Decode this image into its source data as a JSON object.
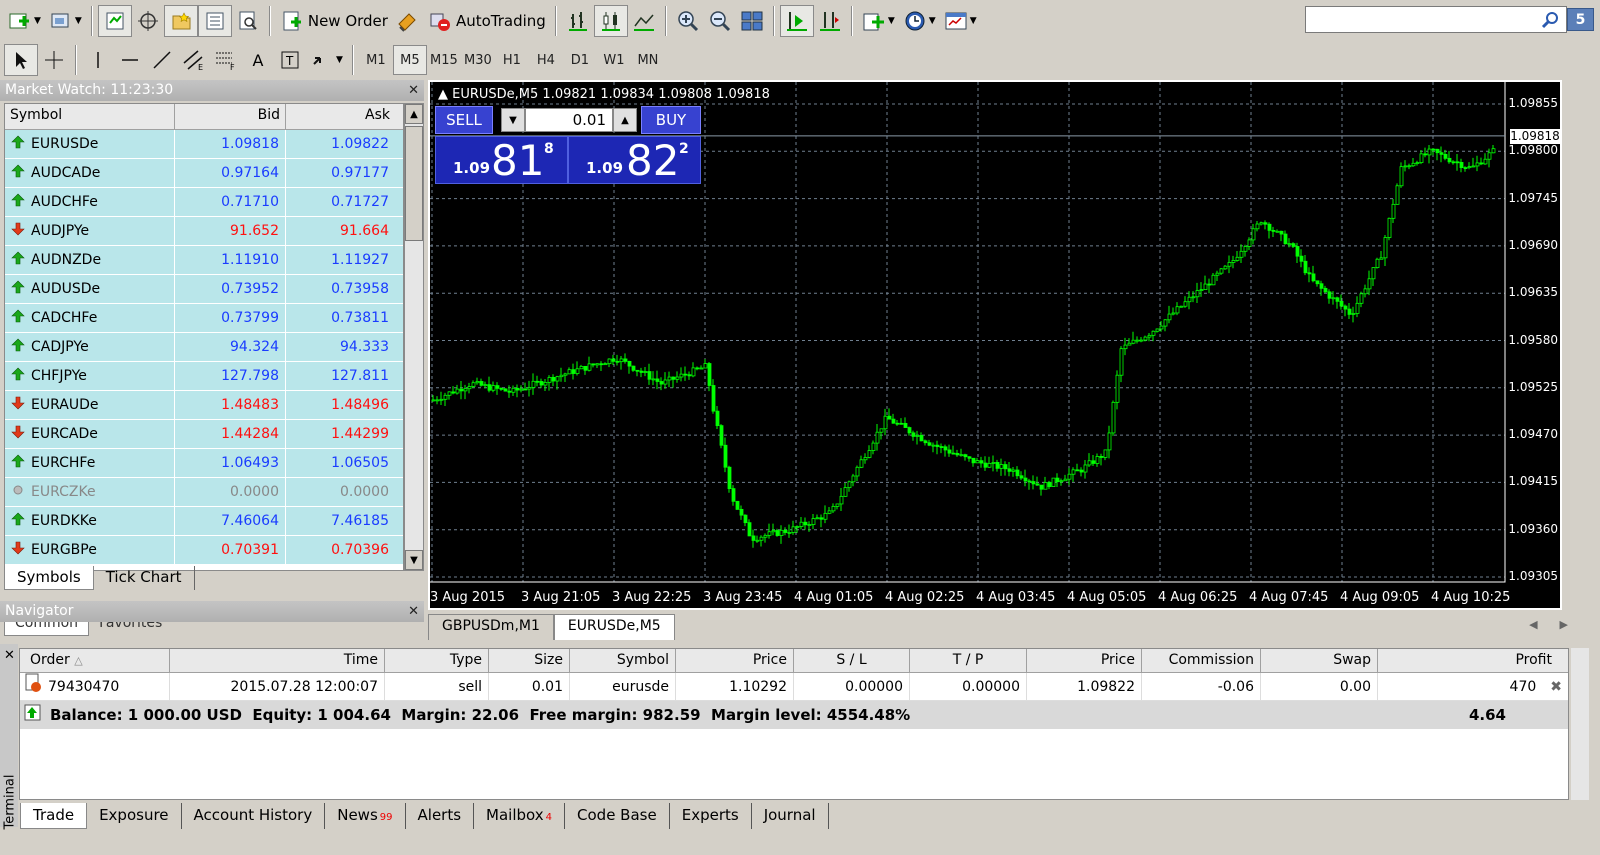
{
  "toolbar": {
    "new_order": "New Order",
    "auto_trading": "AutoTrading",
    "search_placeholder": "",
    "messages_count": "5",
    "timeframes": [
      "M1",
      "M5",
      "M15",
      "M30",
      "H1",
      "H4",
      "D1",
      "W1",
      "MN"
    ],
    "selected_timeframe": "M5"
  },
  "market_watch": {
    "title": "Market Watch: 11:23:30",
    "columns": [
      "Symbol",
      "Bid",
      "Ask"
    ],
    "rows": [
      {
        "symbol": "EURUSDe",
        "bid": "1.09818",
        "ask": "1.09822",
        "dir": "up"
      },
      {
        "symbol": "AUDCADe",
        "bid": "0.97164",
        "ask": "0.97177",
        "dir": "up"
      },
      {
        "symbol": "AUDCHFe",
        "bid": "0.71710",
        "ask": "0.71727",
        "dir": "up"
      },
      {
        "symbol": "AUDJPYe",
        "bid": "91.652",
        "ask": "91.664",
        "dir": "down"
      },
      {
        "symbol": "AUDNZDe",
        "bid": "1.11910",
        "ask": "1.11927",
        "dir": "up"
      },
      {
        "symbol": "AUDUSDe",
        "bid": "0.73952",
        "ask": "0.73958",
        "dir": "up"
      },
      {
        "symbol": "CADCHFe",
        "bid": "0.73799",
        "ask": "0.73811",
        "dir": "up"
      },
      {
        "symbol": "CADJPYe",
        "bid": "94.324",
        "ask": "94.333",
        "dir": "up"
      },
      {
        "symbol": "CHFJPYe",
        "bid": "127.798",
        "ask": "127.811",
        "dir": "up"
      },
      {
        "symbol": "EURAUDe",
        "bid": "1.48483",
        "ask": "1.48496",
        "dir": "down"
      },
      {
        "symbol": "EURCADe",
        "bid": "1.44284",
        "ask": "1.44299",
        "dir": "down"
      },
      {
        "symbol": "EURCHFe",
        "bid": "1.06493",
        "ask": "1.06505",
        "dir": "up"
      },
      {
        "symbol": "EURCZKe",
        "bid": "0.0000",
        "ask": "0.0000",
        "dir": "na"
      },
      {
        "symbol": "EURDKKe",
        "bid": "7.46064",
        "ask": "7.46185",
        "dir": "up"
      },
      {
        "symbol": "EURGBPe",
        "bid": "0.70391",
        "ask": "0.70396",
        "dir": "down"
      }
    ],
    "tabs": [
      "Symbols",
      "Tick Chart"
    ]
  },
  "navigator": {
    "title": "Navigator",
    "tabs": [
      "Common",
      "Favorites"
    ]
  },
  "chart": {
    "title": "EURUSDe,M5  1.09821 1.09834 1.09808 1.09818",
    "sell_label": "SELL",
    "buy_label": "BUY",
    "lot": "0.01",
    "sell_price": {
      "prefix": "1.09",
      "big": "81",
      "sup": "8"
    },
    "buy_price": {
      "prefix": "1.09",
      "big": "82",
      "sup": "2"
    },
    "current_price": "1.09818",
    "y_labels": [
      "1.09855",
      "1.09800",
      "1.09745",
      "1.09690",
      "1.09635",
      "1.09580",
      "1.09525",
      "1.09470",
      "1.09415",
      "1.09360",
      "1.09305"
    ],
    "x_labels": [
      "3 Aug 2015",
      "3 Aug 21:05",
      "3 Aug 22:25",
      "3 Aug 23:45",
      "4 Aug 01:05",
      "4 Aug 02:25",
      "4 Aug 03:45",
      "4 Aug 05:05",
      "4 Aug 06:25",
      "4 Aug 07:45",
      "4 Aug 09:05",
      "4 Aug 10:25"
    ]
  },
  "chart_tabs": [
    "GBPUSDm,M1",
    "EURUSDe,M5"
  ],
  "terminal": {
    "side_label": "Terminal",
    "columns": [
      "Order",
      "Time",
      "Type",
      "Size",
      "Symbol",
      "Price",
      "S / L",
      "T / P",
      "Price",
      "Commission",
      "Swap",
      "Profit"
    ],
    "order": {
      "order": "79430470",
      "time": "2015.07.28 12:00:07",
      "type": "sell",
      "size": "0.01",
      "symbol": "eurusde",
      "open_price": "1.10292",
      "sl": "0.00000",
      "tp": "0.00000",
      "price": "1.09822",
      "commission": "-0.06",
      "swap": "0.00",
      "profit": "470"
    },
    "balance_text": "Balance: 1 000.00 USD  Equity: 1 004.64  Margin: 22.06  Free margin: 982.59  Margin level: 4554.48%",
    "total_profit": "4.64",
    "tabs": [
      {
        "label": "Trade",
        "badge": ""
      },
      {
        "label": "Exposure",
        "badge": ""
      },
      {
        "label": "Account History",
        "badge": ""
      },
      {
        "label": "News",
        "badge": "99"
      },
      {
        "label": "Alerts",
        "badge": ""
      },
      {
        "label": "Mailbox",
        "badge": "4"
      },
      {
        "label": "Code Base",
        "badge": ""
      },
      {
        "label": "Experts",
        "badge": ""
      },
      {
        "label": "Journal",
        "badge": ""
      }
    ]
  },
  "colors": {
    "candle": "#00ff00",
    "chart_bg": "#000000",
    "grid": "#708090",
    "up": "#1a3cff",
    "down": "#ff1010",
    "mw_row": "#b9e6ea"
  }
}
